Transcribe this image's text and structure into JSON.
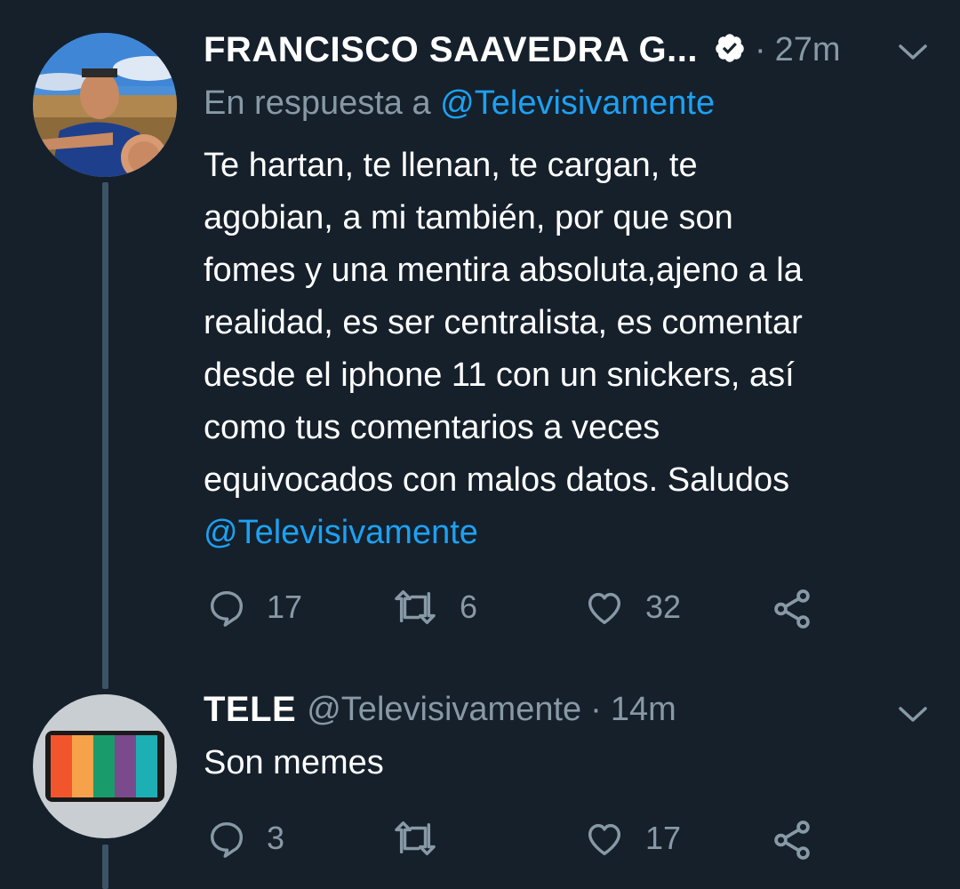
{
  "tweet1": {
    "name": "FRANCISCO SAAVEDRA G...",
    "time": "27m",
    "reply_prefix": "En respuesta a",
    "reply_handle": "@Televisivamente",
    "text": "Te hartan, te llenan, te cargan, te\nagobian, a mi también, por que son\nfomes y una mentira absoluta,ajeno a la\nrealidad, es ser centralista, es comentar\ndesde el iphone 11 con un snickers, así\ncomo tus comentarios a veces\nequivocados con malos datos. Saludos",
    "mention": "@Televisivamente",
    "counts": {
      "replies": "17",
      "retweets": "6",
      "likes": "32"
    }
  },
  "tweet2": {
    "name": "TELE",
    "handle": "@Televisivamente",
    "time": "14m",
    "text": "Son memes",
    "counts": {
      "replies": "3",
      "retweets": "",
      "likes": "17"
    }
  },
  "colors": {
    "background": "#15202b",
    "muted": "#8899a6",
    "link": "#1da1f2",
    "thread_line": "#3d5466",
    "tv_bars": [
      "#f2552c",
      "#f5a24a",
      "#1a9b6c",
      "#7a4a8c",
      "#1cb0b4"
    ]
  },
  "icons": [
    "verified-icon",
    "chevron-down-icon",
    "reply-icon",
    "retweet-icon",
    "like-icon",
    "share-icon"
  ]
}
